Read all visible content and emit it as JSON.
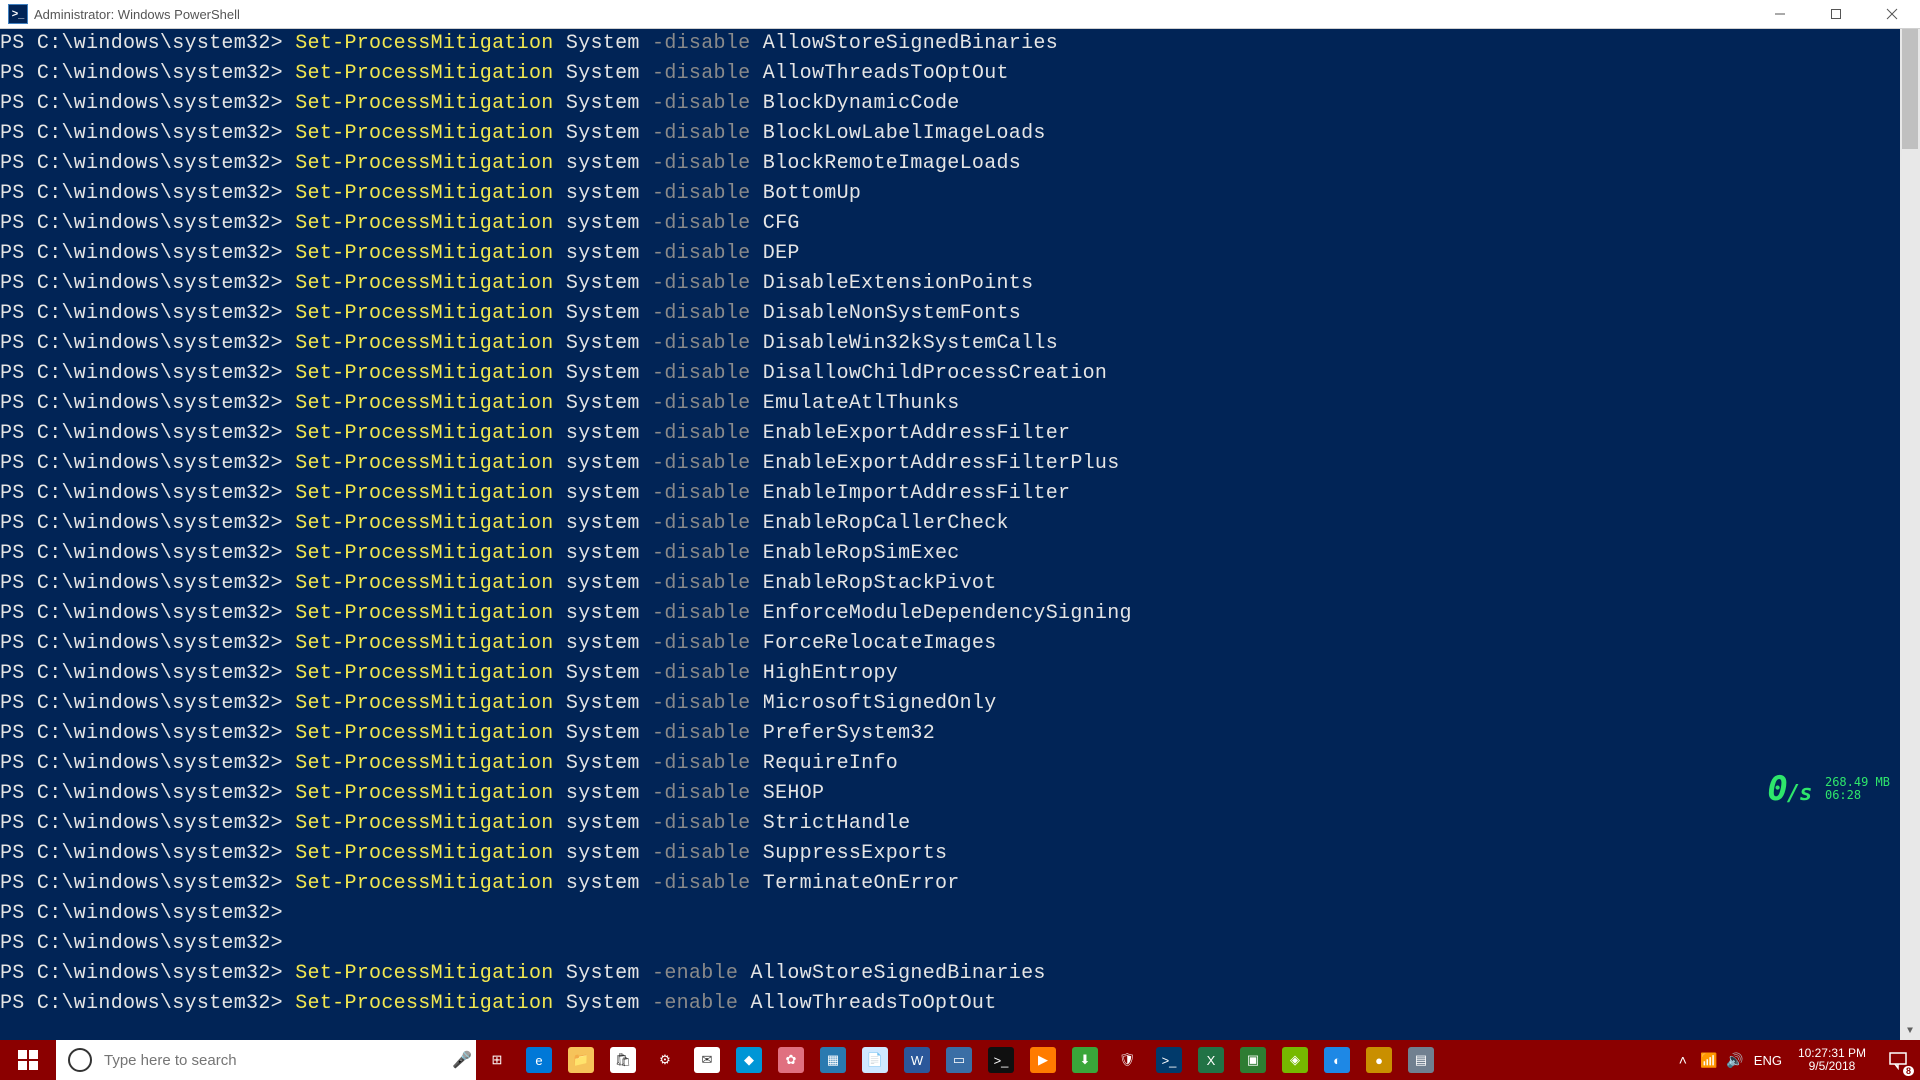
{
  "window": {
    "title": "Administrator: Windows PowerShell",
    "icon_label": ">_"
  },
  "prompt": "PS C:\\windows\\system32> ",
  "cmdlet": "Set-ProcessMitigation",
  "flag_disable": "-disable",
  "flag_enable": "-enable",
  "lines": [
    {
      "target": "System",
      "flag": "-disable",
      "arg": "AllowStoreSignedBinaries"
    },
    {
      "target": "System",
      "flag": "-disable",
      "arg": "AllowThreadsToOptOut"
    },
    {
      "target": "System",
      "flag": "-disable",
      "arg": "BlockDynamicCode"
    },
    {
      "target": "System",
      "flag": "-disable",
      "arg": "BlockLowLabelImageLoads"
    },
    {
      "target": "system",
      "flag": "-disable",
      "arg": "BlockRemoteImageLoads"
    },
    {
      "target": "system",
      "flag": "-disable",
      "arg": "BottomUp"
    },
    {
      "target": "system",
      "flag": "-disable",
      "arg": "CFG"
    },
    {
      "target": "system",
      "flag": "-disable",
      "arg": "DEP"
    },
    {
      "target": "System",
      "flag": "-disable",
      "arg": "DisableExtensionPoints"
    },
    {
      "target": "System",
      "flag": "-disable",
      "arg": "DisableNonSystemFonts"
    },
    {
      "target": "System",
      "flag": "-disable",
      "arg": "DisableWin32kSystemCalls"
    },
    {
      "target": "System",
      "flag": "-disable",
      "arg": "DisallowChildProcessCreation"
    },
    {
      "target": "System",
      "flag": "-disable",
      "arg": "EmulateAtlThunks"
    },
    {
      "target": "system",
      "flag": "-disable",
      "arg": "EnableExportAddressFilter"
    },
    {
      "target": "system",
      "flag": "-disable",
      "arg": "EnableExportAddressFilterPlus"
    },
    {
      "target": "system",
      "flag": "-disable",
      "arg": "EnableImportAddressFilter"
    },
    {
      "target": "system",
      "flag": "-disable",
      "arg": "EnableRopCallerCheck"
    },
    {
      "target": "system",
      "flag": "-disable",
      "arg": "EnableRopSimExec"
    },
    {
      "target": "system",
      "flag": "-disable",
      "arg": "EnableRopStackPivot"
    },
    {
      "target": "system",
      "flag": "-disable",
      "arg": "EnforceModuleDependencySigning"
    },
    {
      "target": "system",
      "flag": "-disable",
      "arg": "ForceRelocateImages"
    },
    {
      "target": "System",
      "flag": "-disable",
      "arg": "HighEntropy"
    },
    {
      "target": "System",
      "flag": "-disable",
      "arg": "MicrosoftSignedOnly"
    },
    {
      "target": "System",
      "flag": "-disable",
      "arg": "PreferSystem32"
    },
    {
      "target": "System",
      "flag": "-disable",
      "arg": "RequireInfo"
    },
    {
      "target": "system",
      "flag": "-disable",
      "arg": "SEHOP"
    },
    {
      "target": "system",
      "flag": "-disable",
      "arg": "StrictHandle"
    },
    {
      "target": "system",
      "flag": "-disable",
      "arg": "SuppressExports"
    },
    {
      "target": "system",
      "flag": "-disable",
      "arg": "TerminateOnError"
    },
    {
      "empty": true
    },
    {
      "empty": true
    },
    {
      "target": "System",
      "flag": "-enable",
      "arg": "AllowStoreSignedBinaries"
    },
    {
      "target": "System",
      "flag": "-enable",
      "arg": "AllowThreadsToOptOut"
    }
  ],
  "hud": {
    "rate": "0",
    "unit": "/s",
    "mem": "268.49 MB",
    "time": "06:28"
  },
  "taskbar": {
    "search_placeholder": "Type here to search",
    "lang": "ENG",
    "time": "10:27:31 PM",
    "date": "9/5/2018",
    "notif_count": "8",
    "icons": [
      {
        "name": "task-view-icon",
        "glyph": "⊞",
        "bg": "transparent"
      },
      {
        "name": "edge-icon",
        "glyph": "e",
        "bg": "#0078d7"
      },
      {
        "name": "file-explorer-icon",
        "glyph": "📁",
        "bg": "#f6c35a"
      },
      {
        "name": "store-icon",
        "glyph": "🛍",
        "bg": "#ffffff"
      },
      {
        "name": "settings-icon",
        "glyph": "⚙",
        "bg": "transparent"
      },
      {
        "name": "mail-icon",
        "glyph": "✉",
        "bg": "#ffffff"
      },
      {
        "name": "app-icon-1",
        "glyph": "◆",
        "bg": "#0096d6"
      },
      {
        "name": "app-icon-2",
        "glyph": "✿",
        "bg": "#e07080"
      },
      {
        "name": "app-icon-3",
        "glyph": "▦",
        "bg": "#2a7ab0"
      },
      {
        "name": "notepad-icon",
        "glyph": "📄",
        "bg": "#cfe8ff"
      },
      {
        "name": "word-icon",
        "glyph": "W",
        "bg": "#2b579a"
      },
      {
        "name": "app-icon-4",
        "glyph": "▭",
        "bg": "#3a6ea5"
      },
      {
        "name": "cmd-icon",
        "glyph": ">_",
        "bg": "#101010"
      },
      {
        "name": "media-icon",
        "glyph": "▶",
        "bg": "#ff7b00"
      },
      {
        "name": "download-icon",
        "glyph": "⬇",
        "bg": "#3aa63a"
      },
      {
        "name": "defender-icon",
        "glyph": "🛡",
        "bg": "transparent"
      },
      {
        "name": "powershell-icon",
        "glyph": ">_",
        "bg": "#013a6b"
      },
      {
        "name": "excel-icon",
        "glyph": "X",
        "bg": "#217346"
      },
      {
        "name": "app-icon-5",
        "glyph": "▣",
        "bg": "#2e7d32"
      },
      {
        "name": "app-icon-6",
        "glyph": "◈",
        "bg": "#76b900"
      },
      {
        "name": "app-icon-7",
        "glyph": "◐",
        "bg": "#1e88e5"
      },
      {
        "name": "app-icon-8",
        "glyph": "●",
        "bg": "#c98f00"
      },
      {
        "name": "app-icon-9",
        "glyph": "▤",
        "bg": "#708090"
      }
    ],
    "tray": [
      {
        "name": "tray-chevron-icon",
        "glyph": "˄"
      },
      {
        "name": "tray-wifi-icon",
        "glyph": "📶"
      },
      {
        "name": "tray-volume-icon",
        "glyph": "🔊"
      }
    ]
  }
}
